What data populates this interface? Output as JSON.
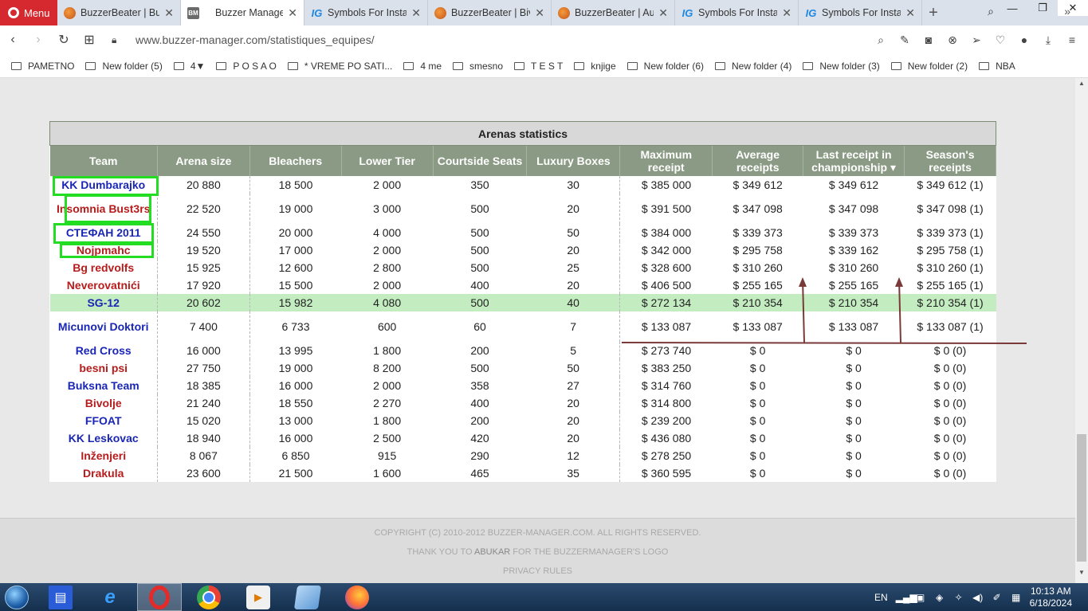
{
  "browser": {
    "menu_label": "Menu",
    "tabs": [
      {
        "title": "BuzzerBeater | Buzz",
        "icon": "basketball-icon",
        "active": false
      },
      {
        "title": "Buzzer Manager : s",
        "icon": "bm-icon",
        "active": true
      },
      {
        "title": "Symbols For Instag",
        "icon": "ig-icon",
        "active": false
      },
      {
        "title": "BuzzerBeater | Bivo",
        "icon": "basketball-icon",
        "active": false
      },
      {
        "title": "BuzzerBeater | Aud",
        "icon": "basketball-icon",
        "active": false
      },
      {
        "title": "Symbols For Instag",
        "icon": "ig-icon",
        "active": false
      },
      {
        "title": "Symbols For Instag",
        "icon": "ig-icon",
        "active": false
      }
    ],
    "url": "www.buzzer-manager.com/statistiques_equipes/",
    "bookmarks": [
      "PAMETNO",
      "New folder (5)",
      "4▼",
      "P O S A O",
      "*   VREME PO SATI...",
      "4 me",
      "smesno",
      "T E S T",
      "knjige",
      "New folder (6)",
      "New folder (4)",
      "New folder (3)",
      "New folder (2)",
      "NBA"
    ]
  },
  "table": {
    "title": "Arenas statistics",
    "headers": [
      "Team",
      "Arena size",
      "Bleachers",
      "Lower Tier",
      "Courtside Seats",
      "Luxury Boxes",
      "Maximum receipt",
      "Average receipts",
      "Last receipt in championship ▾",
      "Season's receipts"
    ],
    "rows": [
      {
        "team": "KK Dumbarajko",
        "color": "blue",
        "cells": [
          "20 880",
          "18 500",
          "2 000",
          "350",
          "30",
          "$ 385 000",
          "$ 349 612",
          "$ 349 612",
          "$ 349 612 (1)"
        ]
      },
      {
        "team": "Insomnia Bust3rs",
        "color": "red",
        "cells": [
          "22 520",
          "19 000",
          "3 000",
          "500",
          "20",
          "$ 391 500",
          "$ 347 098",
          "$ 347 098",
          "$ 347 098 (1)"
        ]
      },
      {
        "team": "СТЕФАН 2011",
        "color": "blue",
        "cells": [
          "24 550",
          "20 000",
          "4 000",
          "500",
          "50",
          "$ 384 000",
          "$ 339 373",
          "$ 339 373",
          "$ 339 373 (1)"
        ]
      },
      {
        "team": "Nojpmahc",
        "color": "red",
        "cells": [
          "19 520",
          "17 000",
          "2 000",
          "500",
          "20",
          "$ 342 000",
          "$ 295 758",
          "$ 339 162",
          "$ 295 758 (1)"
        ]
      },
      {
        "team": "Bg redvolfs",
        "color": "red",
        "cells": [
          "15 925",
          "12 600",
          "2 800",
          "500",
          "25",
          "$ 328 600",
          "$ 310 260",
          "$ 310 260",
          "$ 310 260 (1)"
        ]
      },
      {
        "team": "Neverovatnići",
        "color": "red",
        "cells": [
          "17 920",
          "15 500",
          "2 000",
          "400",
          "20",
          "$ 406 500",
          "$ 255 165",
          "$ 255 165",
          "$ 255 165 (1)"
        ]
      },
      {
        "team": "SG-12",
        "color": "blue",
        "highlight": true,
        "cells": [
          "20 602",
          "15 982",
          "4 080",
          "500",
          "40",
          "$ 272 134",
          "$ 210 354",
          "$ 210 354",
          "$ 210 354 (1)"
        ]
      },
      {
        "team": "Micunovi Doktori",
        "color": "blue",
        "cells": [
          "7 400",
          "6 733",
          "600",
          "60",
          "7",
          "$ 133 087",
          "$ 133 087",
          "$ 133 087",
          "$ 133 087 (1)"
        ]
      },
      {
        "team": "Red Cross",
        "color": "blue",
        "cells": [
          "16 000",
          "13 995",
          "1 800",
          "200",
          "5",
          "$ 273 740",
          "$ 0",
          "$ 0",
          "$ 0 (0)"
        ]
      },
      {
        "team": "besni psi",
        "color": "red",
        "cells": [
          "27 750",
          "19 000",
          "8 200",
          "500",
          "50",
          "$ 383 250",
          "$ 0",
          "$ 0",
          "$ 0 (0)"
        ]
      },
      {
        "team": "Buksna Team",
        "color": "blue",
        "cells": [
          "18 385",
          "16 000",
          "2 000",
          "358",
          "27",
          "$ 314 760",
          "$ 0",
          "$ 0",
          "$ 0 (0)"
        ]
      },
      {
        "team": "Bivolje",
        "color": "red",
        "cells": [
          "21 240",
          "18 550",
          "2 270",
          "400",
          "20",
          "$ 314 800",
          "$ 0",
          "$ 0",
          "$ 0 (0)"
        ]
      },
      {
        "team": "FFOAT",
        "color": "blue",
        "cells": [
          "15 020",
          "13 000",
          "1 800",
          "200",
          "20",
          "$ 239 200",
          "$ 0",
          "$ 0",
          "$ 0 (0)"
        ]
      },
      {
        "team": "KK Leskovac",
        "color": "blue",
        "cells": [
          "18 940",
          "16 000",
          "2 500",
          "420",
          "20",
          "$ 436 080",
          "$ 0",
          "$ 0",
          "$ 0 (0)"
        ]
      },
      {
        "team": "Inženjeri",
        "color": "red",
        "cells": [
          "8 067",
          "6 850",
          "915",
          "290",
          "12",
          "$ 278 250",
          "$ 0",
          "$ 0",
          "$ 0 (0)"
        ]
      },
      {
        "team": "Drakula",
        "color": "red",
        "cells": [
          "23 600",
          "21 500",
          "1 600",
          "465",
          "35",
          "$ 360 595",
          "$ 0",
          "$ 0",
          "$ 0 (0)"
        ]
      }
    ]
  },
  "footer": {
    "copyright": "COPYRIGHT (C) 2010-2012 BUZZER-MANAGER.COM. ALL RIGHTS RESERVED.",
    "thanks_pre": "THANK YOU TO ",
    "thanks_name": "ABUKAR",
    "thanks_post": " FOR THE BUZZERMANAGER'S LOGO",
    "privacy": "PRIVACY RULES"
  },
  "taskbar": {
    "lang": "EN",
    "time": "10:13 AM",
    "date": "6/18/2024"
  },
  "colors": {
    "header_bg": "#8b9a84",
    "highlight_row": "#c3ecc0",
    "team_blue": "#1a26b5",
    "team_red": "#b71c1c",
    "annotation_box": "#22dd22",
    "annotation_line": "#7a3a3a"
  }
}
